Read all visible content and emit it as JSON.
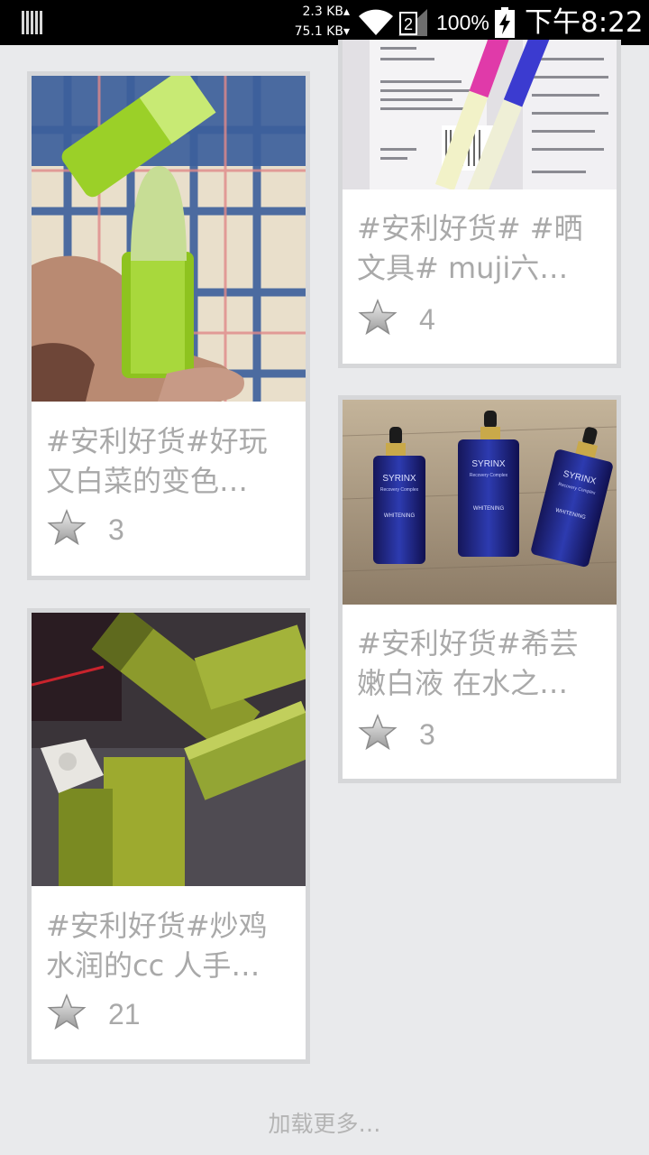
{
  "status_bar": {
    "speed_up": "2.3 KB▴",
    "speed_down": "75.1 KB▾",
    "battery_percent": "100%",
    "time": "下午8:22",
    "icons": [
      "notification-bars-icon",
      "wifi-icon",
      "sim-no-signal-icon",
      "battery-charging-icon"
    ]
  },
  "feed": {
    "items": [
      {
        "title": "#安利好货#好玩\n又白菜的变色…",
        "likes": "3",
        "image": "green-lipstick-photo"
      },
      {
        "title": "#安利好货#炒鸡\n水润的cc 人手…",
        "likes": "21",
        "image": "green-cc-cream-boxes-photo"
      },
      {
        "title": "#安利好货# #晒\n文具# muji六…",
        "likes": "4",
        "image": "receipt-and-pens-photo"
      },
      {
        "title": "#安利好货#希芸\n嫩白液 在水之…",
        "likes": "3",
        "image": "blue-serum-bottles-photo"
      }
    ]
  },
  "load_more_label": "加载更多…",
  "bottle_label_brand": "SYRINX",
  "bottle_label_sub": "Recovery Complex",
  "bottle_label_type": "WHITENING",
  "colors": {
    "background": "#e9eaec",
    "card_border": "#d6d7d9",
    "text_grey": "#a9a9a9"
  }
}
